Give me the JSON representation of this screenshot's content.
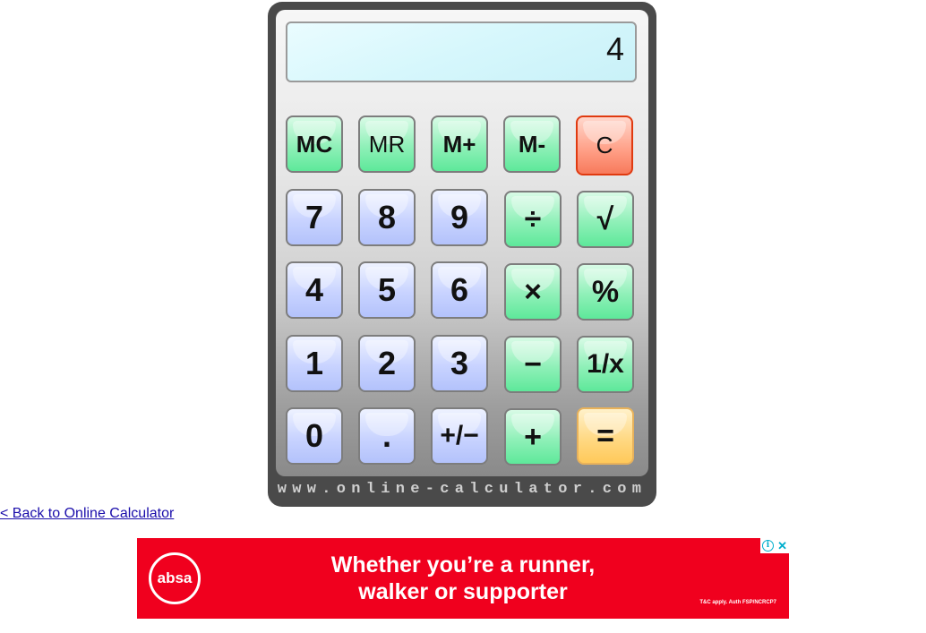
{
  "display": {
    "value": "4"
  },
  "keys": {
    "mc": "MC",
    "mr": "MR",
    "m_plus": "M+",
    "m_minus": "M-",
    "clear": "C",
    "seven": "7",
    "eight": "8",
    "nine": "9",
    "divide": "÷",
    "sqrt": "√",
    "four": "4",
    "five": "5",
    "six": "6",
    "multiply": "×",
    "percent": "%",
    "one": "1",
    "two": "2",
    "three": "3",
    "minus": "−",
    "reciprocal": "1/x",
    "zero": "0",
    "decimal": ".",
    "sign": "+/−",
    "plus": "+",
    "equals": "="
  },
  "brand": "www.online-calculator.com",
  "nav": {
    "back_link": "< Back to Online Calculator"
  },
  "ad": {
    "logo": "absa",
    "headline_line1": "Whether you’re a runner,",
    "headline_line2": "walker or supporter",
    "fine_print": "T&C apply. Auth FSP/NCRCP7",
    "info_icon_glyph": "i",
    "close_icon_glyph": "✕"
  },
  "colors": {
    "body": "#4a4a4a",
    "display_bg": "#d6f7fc",
    "key_green": "#8ff0b8",
    "key_blue": "#c8d3ff",
    "key_clear": "#ff9e85",
    "key_equals": "#ffd77f",
    "ad_red": "#f0001e",
    "link": "#1a0dab"
  },
  "icons": {
    "ad_info": "info-icon",
    "ad_close": "close-icon"
  }
}
